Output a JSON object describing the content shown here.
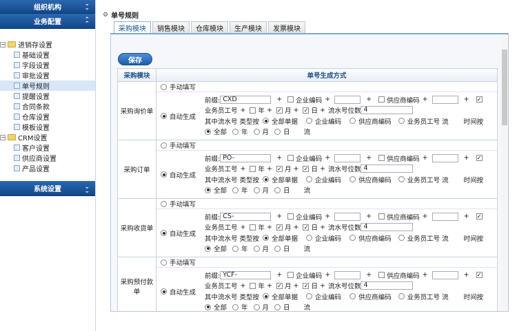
{
  "sidebar": {
    "section_org": "组织机构",
    "section_business": "业务配置",
    "section_system": "系统设置",
    "tree": {
      "group1": "进销存设置",
      "items1": [
        "基础设置",
        "字段设置",
        "审批设置",
        "单号规则",
        "提醒设置",
        "合同条款",
        "仓库设置",
        "模板设置"
      ],
      "group2": "CRM设置",
      "items2": [
        "客户设置",
        "供应商设置",
        "产品设置"
      ]
    }
  },
  "page": {
    "title": "单号规则"
  },
  "tabs": [
    "采购模块",
    "销售模块",
    "仓库模块",
    "生产模块",
    "发票模块"
  ],
  "toolbar": {
    "save": "保存"
  },
  "table": {
    "col1": "采购模块",
    "col2": "单号生成方式"
  },
  "labels": {
    "manual": "手动填写",
    "auto": "自动生成",
    "prefix": "前缀:",
    "plus": "+",
    "company": "企业编码",
    "supplier": "供应商编码",
    "staff": "业务员工号",
    "year": "年",
    "month": "月",
    "day": "日",
    "serial_digits": "流水号位数",
    "serial_by": "其中流水号 类型按",
    "all_docs": "全部单据",
    "staff_serial": "业务员工号 流",
    "time_by": "时间按",
    "all": "全部",
    "flow": "流"
  },
  "rows": [
    {
      "name": "采购询价单",
      "prefix": "CXD",
      "digits": "4"
    },
    {
      "name": "采购订单",
      "prefix": "PO-",
      "digits": "4"
    },
    {
      "name": "采购收货单",
      "prefix": "CS-",
      "digits": "4"
    },
    {
      "name": "采购预付款单",
      "prefix": "YCF-",
      "digits": "4"
    }
  ]
}
